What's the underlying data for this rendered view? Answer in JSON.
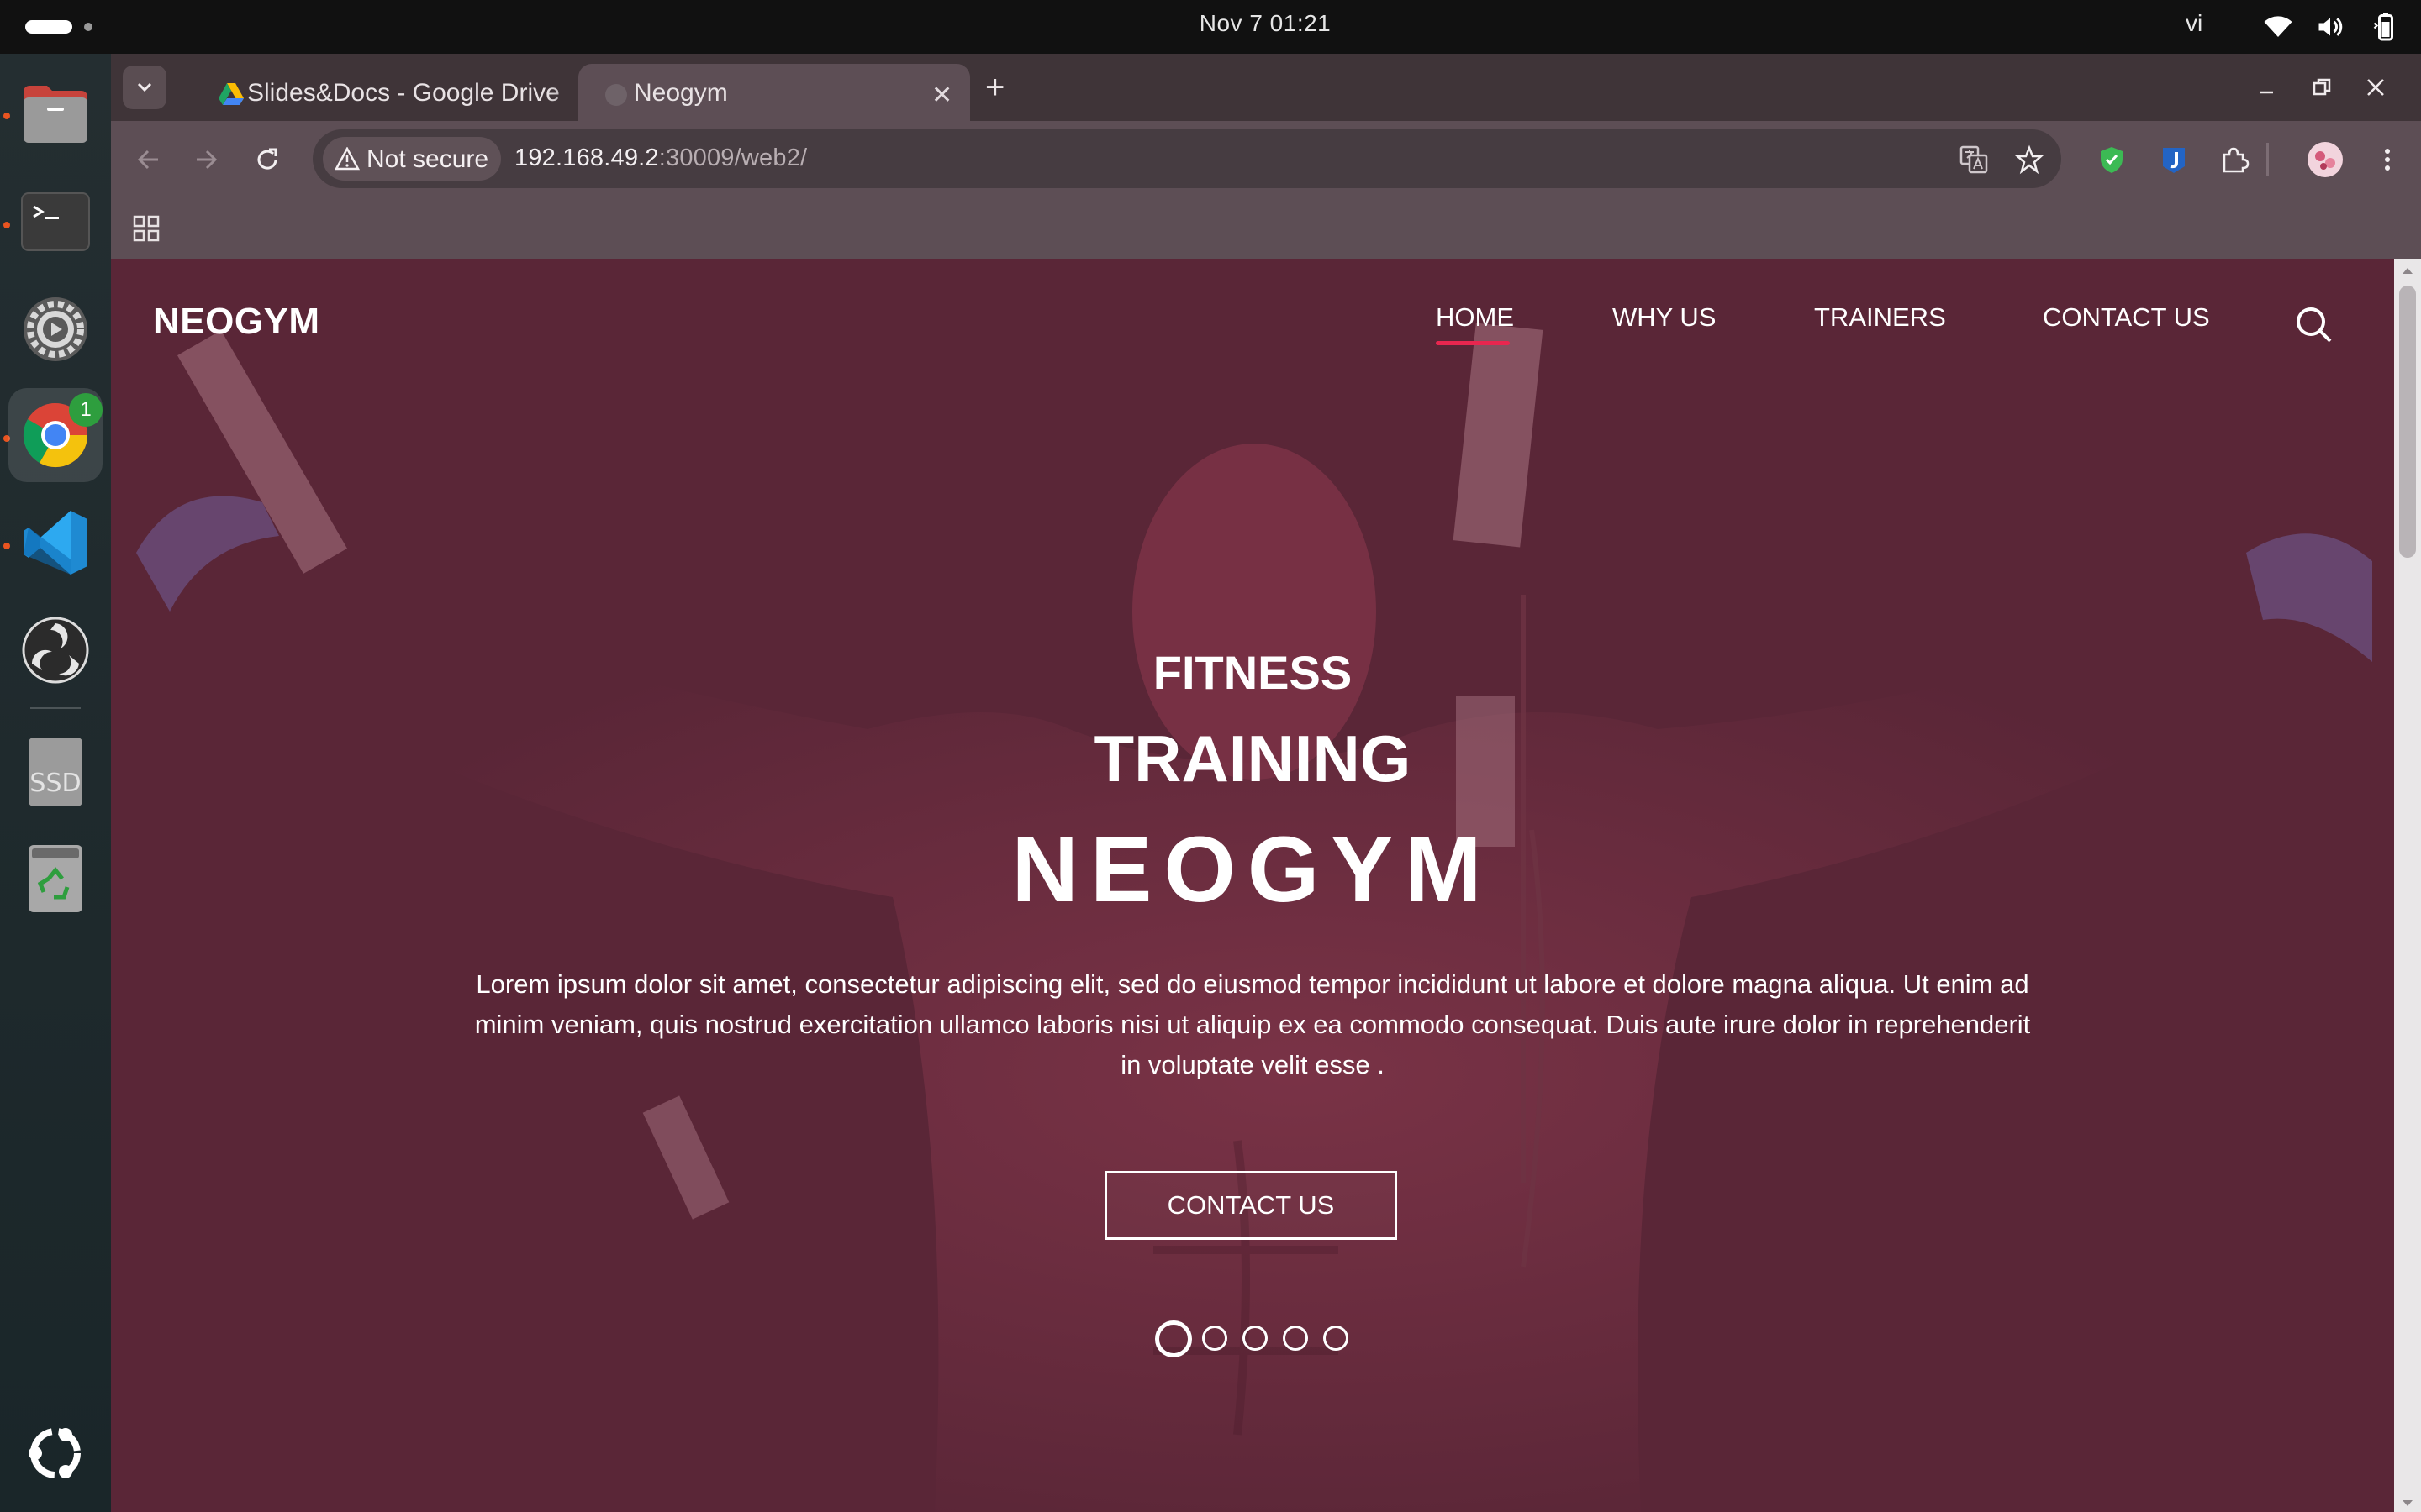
{
  "system": {
    "clock": "Nov 7  01:21",
    "input_language": "vi"
  },
  "dock": {
    "items": [
      "files",
      "terminal",
      "settings",
      "chrome",
      "vscode",
      "obs-studio",
      "ssd-drive",
      "trash",
      "show-apps"
    ],
    "chrome_badge": "1",
    "ssd_label": "SSD"
  },
  "browser": {
    "tabs": [
      {
        "title": "Slides&Docs - Google Drive",
        "active": false
      },
      {
        "title": "Neogym",
        "active": true
      }
    ],
    "security_label": "Not secure",
    "url_host": "192.168.49.2",
    "url_path": ":30009/web2/"
  },
  "page": {
    "brand": "NEOGYM",
    "nav": [
      {
        "label": "HOME",
        "active": true
      },
      {
        "label": "WHY US"
      },
      {
        "label": "TRAINERS"
      },
      {
        "label": "CONTACT US"
      }
    ],
    "hero": {
      "kicker": "FITNESS",
      "headline": "TRAINING",
      "brandline": "NEOGYM",
      "body": "Lorem ipsum dolor sit amet, consectetur adipiscing elit, sed do eiusmod tempor incididunt ut labore et dolore magna aliqua. Ut enim ad minim veniam, quis nostrud exercitation ullamco laboris nisi ut aliquip ex ea commodo consequat. Duis aute irure dolor in reprehenderit in voluptate velit esse .",
      "cta_label": "CONTACT US",
      "slides_total": 5,
      "slide_active": 1
    },
    "colors": {
      "overlay": "#5a2637",
      "accent": "#e8264f"
    }
  }
}
